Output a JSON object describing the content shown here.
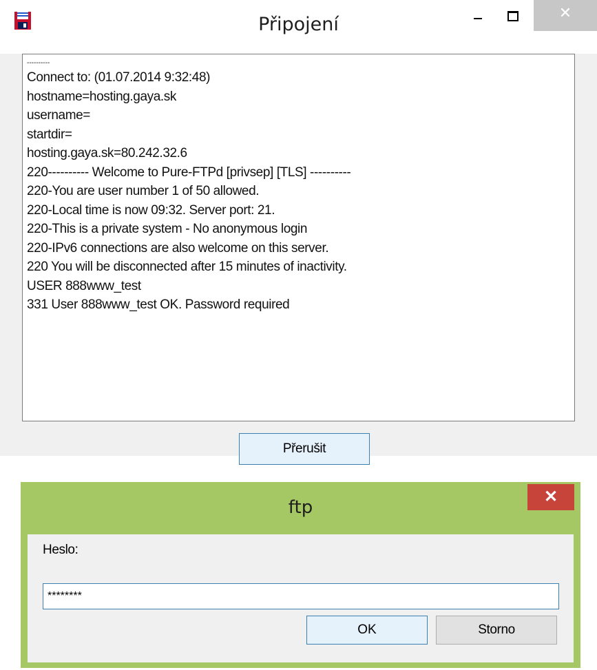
{
  "connect_window": {
    "title": "Připojení",
    "icon": "floppy-disk-icon",
    "log_lines": [
      "----------",
      "Connect to: (01.07.2014 9:32:48)",
      "hostname=hosting.gaya.sk",
      "username=",
      "startdir=",
      "hosting.gaya.sk=80.242.32.6",
      "220---------- Welcome to Pure-FTPd [privsep] [TLS] ----------",
      "220-You are user number 1 of 50 allowed.",
      "220-Local time is now 09:32. Server port: 21.",
      "220-This is a private system - No anonymous login",
      "220-IPv6 connections are also welcome on this server.",
      "220 You will be disconnected after 15 minutes of inactivity.",
      "USER 888www_test",
      "331 User 888www_test OK. Password required"
    ],
    "abort_label": "Přerušit"
  },
  "password_dialog": {
    "title": "ftp",
    "label": "Heslo:",
    "password_value": "********",
    "ok_label": "OK",
    "cancel_label": "Storno",
    "accent_color": "#a5c864",
    "close_color": "#c7443b"
  }
}
